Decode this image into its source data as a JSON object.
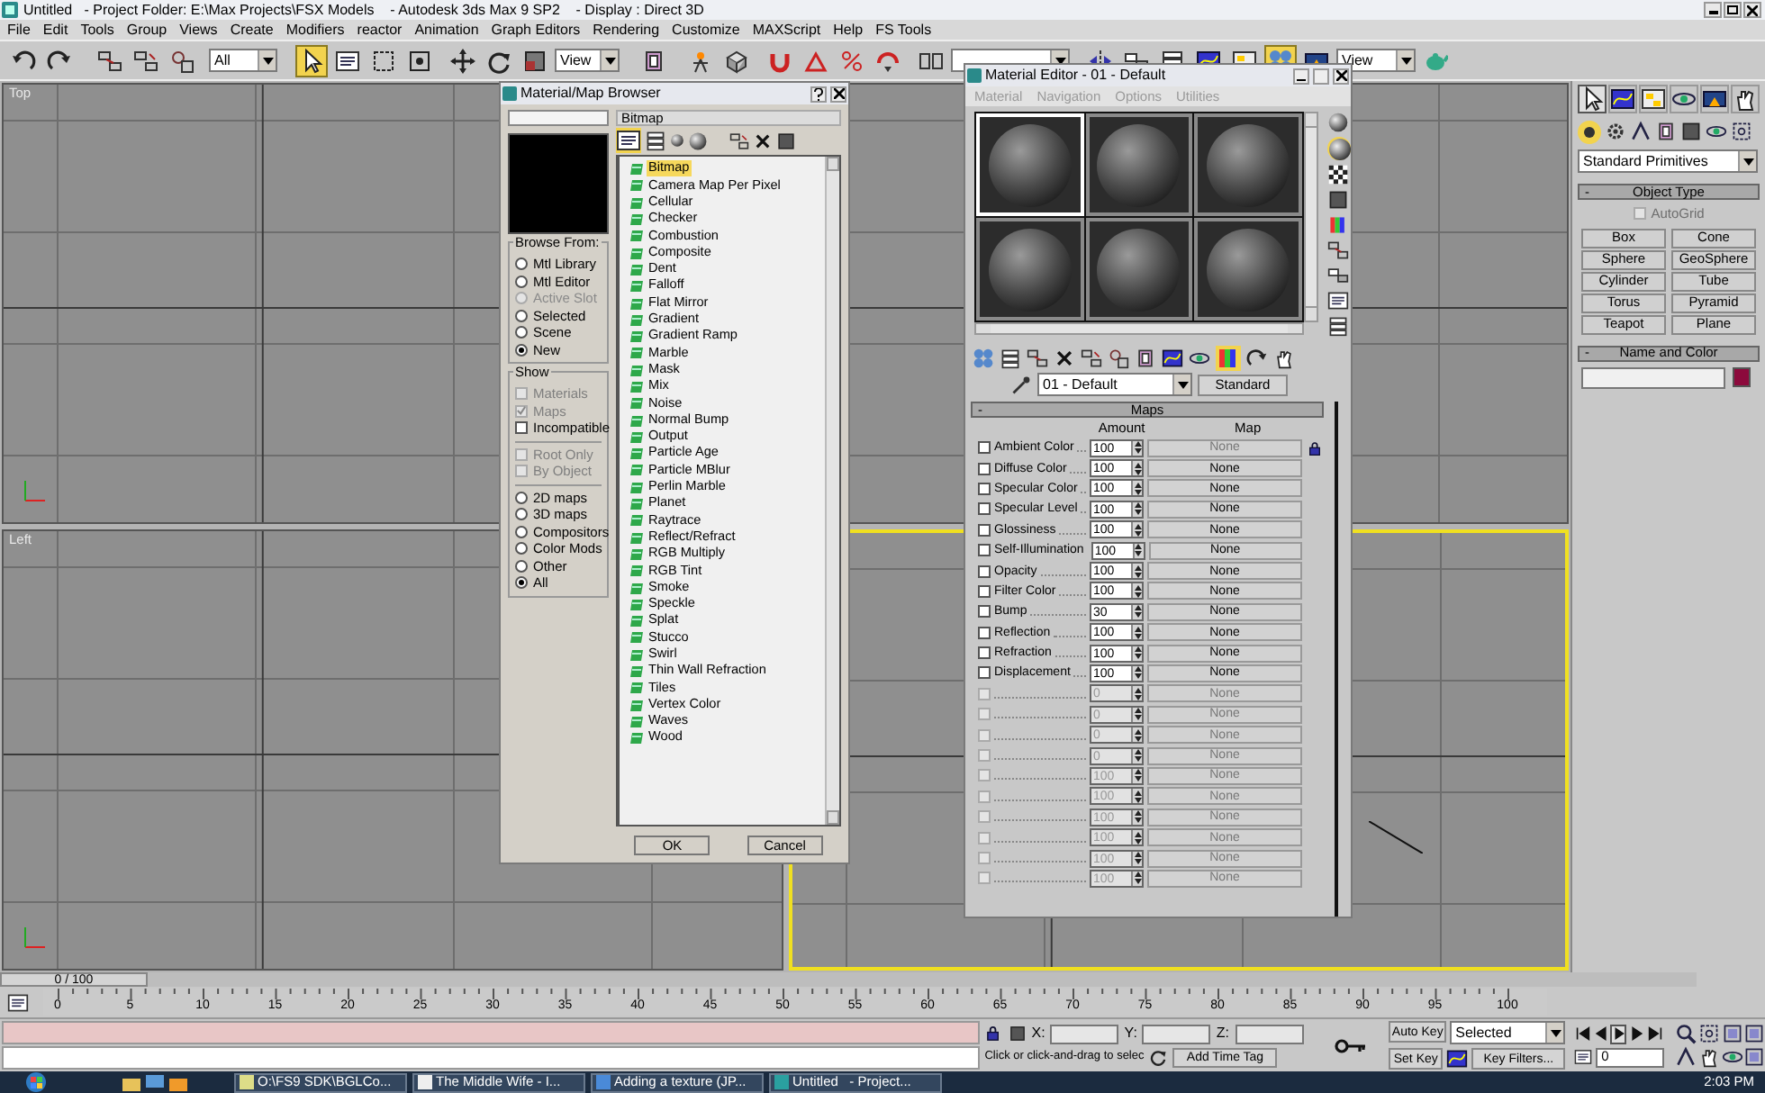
{
  "title_bar": {
    "title": "Untitled   - Project Folder: E:\\Max Projects\\FSX Models    - Autodesk 3ds Max 9 SP2    - Display : Direct 3D"
  },
  "menu": [
    "File",
    "Edit",
    "Tools",
    "Group",
    "Views",
    "Create",
    "Modifiers",
    "reactor",
    "Animation",
    "Graph Editors",
    "Rendering",
    "Customize",
    "MAXScript",
    "Help",
    "FS Tools"
  ],
  "toolbar": {
    "selection_filter": "All",
    "reference_coord": "View",
    "render_view": "View"
  },
  "viewports": [
    {
      "label": "Top",
      "active": false
    },
    {
      "active": false
    },
    {
      "label": "Left",
      "active": false
    },
    {
      "active": true
    }
  ],
  "map_browser": {
    "title": "Material/Map Browser",
    "path": "Bitmap",
    "browse_from_title": "Browse From:",
    "browse_from": [
      {
        "label": "Mtl Library",
        "selected": false,
        "disabled": false
      },
      {
        "label": "Mtl Editor",
        "selected": false,
        "disabled": false
      },
      {
        "label": "Active Slot",
        "selected": false,
        "disabled": true
      },
      {
        "label": "Selected",
        "selected": false,
        "disabled": false
      },
      {
        "label": "Scene",
        "selected": false,
        "disabled": false
      },
      {
        "label": "New",
        "selected": true,
        "disabled": false
      }
    ],
    "show_title": "Show",
    "show": [
      {
        "label": "Materials",
        "checked": false,
        "disabled": true
      },
      {
        "label": "Maps",
        "checked": true,
        "disabled": true
      },
      {
        "label": "Incompatible",
        "checked": false,
        "disabled": false
      }
    ],
    "show_extra": [
      {
        "label": "Root Only",
        "checked": false,
        "disabled": true
      },
      {
        "label": "By Object",
        "checked": false,
        "disabled": true
      }
    ],
    "filter": [
      {
        "label": "2D maps",
        "selected": false
      },
      {
        "label": "3D maps",
        "selected": false
      },
      {
        "label": "Compositors",
        "selected": false
      },
      {
        "label": "Color Mods",
        "selected": false
      },
      {
        "label": "Other",
        "selected": false
      },
      {
        "label": "All",
        "selected": true
      }
    ],
    "items": [
      {
        "label": "Bitmap",
        "selected": true
      },
      {
        "label": "Camera Map Per Pixel",
        "selected": false
      },
      {
        "label": "Cellular",
        "selected": false
      },
      {
        "label": "Checker",
        "selected": false
      },
      {
        "label": "Combustion",
        "selected": false
      },
      {
        "label": "Composite",
        "selected": false
      },
      {
        "label": "Dent",
        "selected": false
      },
      {
        "label": "Falloff",
        "selected": false
      },
      {
        "label": "Flat Mirror",
        "selected": false
      },
      {
        "label": "Gradient",
        "selected": false
      },
      {
        "label": "Gradient Ramp",
        "selected": false
      },
      {
        "label": "Marble",
        "selected": false
      },
      {
        "label": "Mask",
        "selected": false
      },
      {
        "label": "Mix",
        "selected": false
      },
      {
        "label": "Noise",
        "selected": false
      },
      {
        "label": "Normal Bump",
        "selected": false
      },
      {
        "label": "Output",
        "selected": false
      },
      {
        "label": "Particle Age",
        "selected": false
      },
      {
        "label": "Particle MBlur",
        "selected": false
      },
      {
        "label": "Perlin Marble",
        "selected": false
      },
      {
        "label": "Planet",
        "selected": false
      },
      {
        "label": "Raytrace",
        "selected": false
      },
      {
        "label": "Reflect/Refract",
        "selected": false
      },
      {
        "label": "RGB Multiply",
        "selected": false
      },
      {
        "label": "RGB Tint",
        "selected": false
      },
      {
        "label": "Smoke",
        "selected": false
      },
      {
        "label": "Speckle",
        "selected": false
      },
      {
        "label": "Splat",
        "selected": false
      },
      {
        "label": "Stucco",
        "selected": false
      },
      {
        "label": "Swirl",
        "selected": false
      },
      {
        "label": "Thin Wall Refraction",
        "selected": false
      },
      {
        "label": "Tiles",
        "selected": false
      },
      {
        "label": "Vertex Color",
        "selected": false
      },
      {
        "label": "Waves",
        "selected": false
      },
      {
        "label": "Wood",
        "selected": false
      }
    ],
    "buttons": [
      "OK",
      "Cancel"
    ]
  },
  "material_editor": {
    "title": "Material Editor - 01 - Default",
    "menu": [
      "Material",
      "Navigation",
      "Options",
      "Utilities"
    ],
    "slots": [
      {
        "selected": true
      },
      {
        "selected": false
      },
      {
        "selected": false
      },
      {
        "selected": false
      },
      {
        "selected": false
      },
      {
        "selected": false
      }
    ],
    "material_name": "01 - Default",
    "type_button": "Standard",
    "maps": {
      "toggle": "-",
      "title": "Maps",
      "columns": [
        "Amount",
        "Map"
      ],
      "rows": [
        {
          "label": "Ambient Color",
          "checked": false,
          "amount": "100",
          "map": "None",
          "locked": true,
          "disabled": false
        },
        {
          "label": "Diffuse Color",
          "checked": false,
          "amount": "100",
          "map": "None",
          "locked": false,
          "disabled": false
        },
        {
          "label": "Specular Color",
          "checked": false,
          "amount": "100",
          "map": "None",
          "locked": false,
          "disabled": false
        },
        {
          "label": "Specular Level",
          "checked": false,
          "amount": "100",
          "map": "None",
          "locked": false,
          "disabled": false
        },
        {
          "label": "Glossiness",
          "checked": false,
          "amount": "100",
          "map": "None",
          "locked": false,
          "disabled": false
        },
        {
          "label": "Self-Illumination",
          "checked": false,
          "amount": "100",
          "map": "None",
          "locked": false,
          "disabled": false
        },
        {
          "label": "Opacity",
          "checked": false,
          "amount": "100",
          "map": "None",
          "locked": false,
          "disabled": false
        },
        {
          "label": "Filter Color",
          "checked": false,
          "amount": "100",
          "map": "None",
          "locked": false,
          "disabled": false
        },
        {
          "label": "Bump",
          "checked": false,
          "amount": "30",
          "map": "None",
          "locked": false,
          "disabled": false
        },
        {
          "label": "Reflection",
          "checked": false,
          "amount": "100",
          "map": "None",
          "locked": false,
          "disabled": false
        },
        {
          "label": "Refraction",
          "checked": false,
          "amount": "100",
          "map": "None",
          "locked": false,
          "disabled": false
        },
        {
          "label": "Displacement",
          "checked": false,
          "amount": "100",
          "map": "None",
          "locked": false,
          "disabled": false
        },
        {
          "checked": false,
          "amount": "0",
          "map": "None",
          "locked": false,
          "disabled": true
        },
        {
          "checked": false,
          "amount": "0",
          "map": "None",
          "locked": false,
          "disabled": true
        },
        {
          "checked": false,
          "amount": "0",
          "map": "None",
          "locked": false,
          "disabled": true
        },
        {
          "checked": false,
          "amount": "0",
          "map": "None",
          "locked": false,
          "disabled": true
        },
        {
          "checked": false,
          "amount": "100",
          "map": "None",
          "locked": false,
          "disabled": true
        },
        {
          "checked": false,
          "amount": "100",
          "map": "None",
          "locked": false,
          "disabled": true
        },
        {
          "checked": false,
          "amount": "100",
          "map": "None",
          "locked": false,
          "disabled": true
        },
        {
          "checked": false,
          "amount": "100",
          "map": "None",
          "locked": false,
          "disabled": true
        },
        {
          "checked": false,
          "amount": "100",
          "map": "None",
          "locked": false,
          "disabled": true
        },
        {
          "checked": false,
          "amount": "100",
          "map": "None",
          "locked": false,
          "disabled": true
        }
      ]
    }
  },
  "command_panel": {
    "tabs": [
      {
        "selected": true
      },
      {
        "selected": false
      },
      {
        "selected": false
      },
      {
        "selected": false
      },
      {
        "selected": false
      },
      {
        "selected": false
      }
    ],
    "dropdown": "Standard Primitives",
    "object_type": {
      "toggle": "-",
      "title": "Object Type",
      "autogrid": {
        "label": "AutoGrid",
        "checked": false,
        "disabled": true
      },
      "buttons": [
        "Box",
        "Cone",
        "Sphere",
        "GeoSphere",
        "Cylinder",
        "Tube",
        "Torus",
        "Pyramid",
        "Teapot",
        "Plane"
      ]
    },
    "name_and_color": {
      "toggle": "-",
      "title": "Name and Color",
      "color": "#8c0a3c"
    }
  },
  "timeline": {
    "frame": "0 / 100",
    "ticks": [
      "0",
      "5",
      "10",
      "15",
      "20",
      "25",
      "30",
      "35",
      "40",
      "45",
      "50",
      "55",
      "60",
      "65",
      "70",
      "75",
      "80",
      "85",
      "90",
      "95",
      "100"
    ]
  },
  "status": {
    "x_label": "X:",
    "y_label": "Y:",
    "z_label": "Z:",
    "auto_key": "Auto Key",
    "selection": "Selected",
    "set_key": "Set Key",
    "key_filters": "Key Filters...",
    "prompt": "Click or click-and-drag to selec",
    "add_time_tag": "Add Time Tag",
    "frame_field": "0"
  },
  "taskbar": {
    "items": [
      "O:\\FS9 SDK\\BGLCo...",
      "The Middle Wife - I...",
      "Adding a texture (JP...",
      "Untitled   - Project..."
    ],
    "clock": "2:03 PM"
  }
}
